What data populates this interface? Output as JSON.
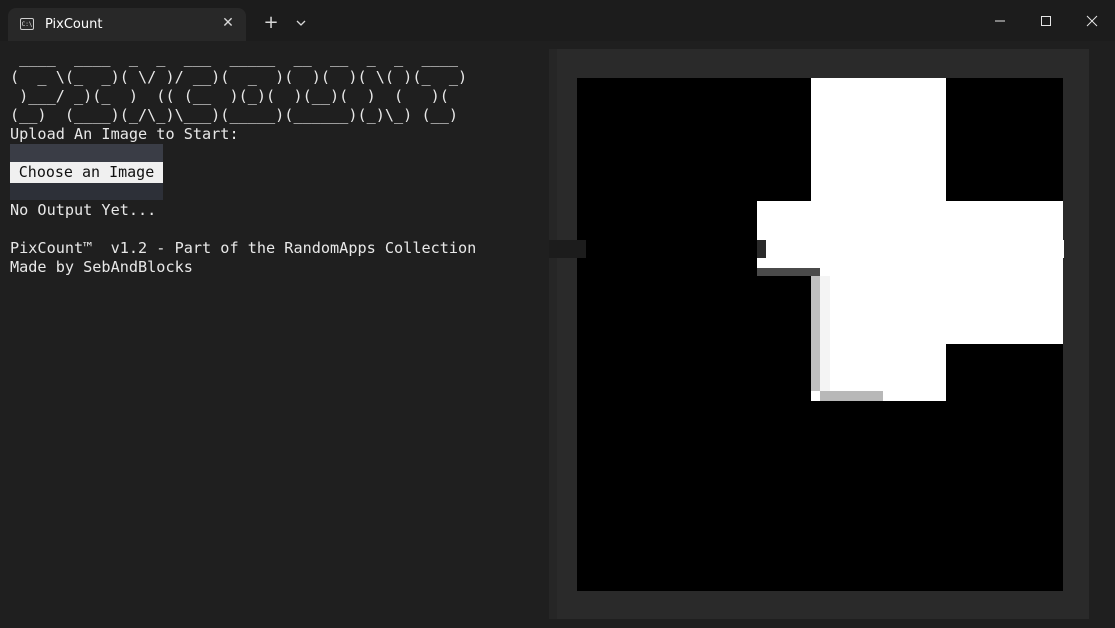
{
  "window": {
    "tab_title": "PixCount",
    "tab_icon": "terminal-icon",
    "close_tab_glyph": "✕",
    "new_tab_glyph": "+"
  },
  "app": {
    "ascii_banner": [
      " ____  ____  _  _  ___  _____  __  __  _  _  ____ ",
      "(  _ \\(_  _)( \\/ )/ __)(  _  )(  )(  )( \\( )(_  _)",
      " )___/ _)(_  )  (( (__  )(_)(  )(__)(  )  (   )(  ",
      "(__)  (____)(_/\\_)\\___)(_____)(______)(_)\\_) (__) "
    ],
    "upload_label": "Upload An Image to Start:",
    "choose_button": "Choose an Image",
    "output_text": "No Output Yet...",
    "version_text": "PixCount™  v1.2 - Part of the RandomApps Collection",
    "author_text": "Made by SebAndBlocks"
  },
  "colors": {
    "background": "#1f1f1f",
    "text": "#e8e8e8",
    "canvas": "#000000",
    "shape": "#ffffff"
  }
}
